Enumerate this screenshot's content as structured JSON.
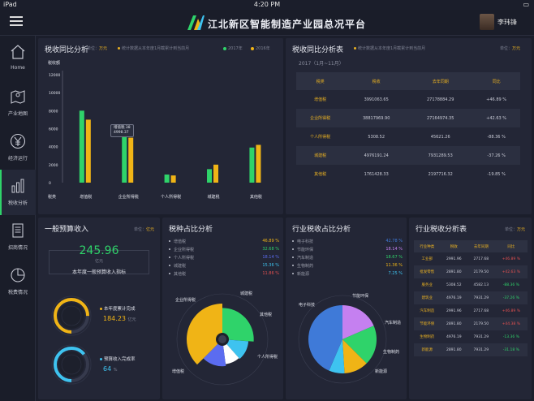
{
  "status": {
    "carrier": "iPad",
    "time": "4:20 PM",
    "battery": "100%"
  },
  "header": {
    "title": "江北新区智能制造产业园总况平台",
    "user": "李玮锋"
  },
  "nav": [
    {
      "label": "Home",
      "icon": "home-icon"
    },
    {
      "label": "产业地图",
      "icon": "map-pin-icon"
    },
    {
      "label": "经济运行",
      "icon": "yen-icon"
    },
    {
      "label": "税收分析",
      "icon": "bar-chart-icon"
    },
    {
      "label": "招商情况",
      "icon": "document-icon"
    },
    {
      "label": "税费情况",
      "icon": "pie-icon"
    }
  ],
  "tax_compare": {
    "title": "税收同比分析",
    "unit_label": "单位：",
    "unit_value": "万元",
    "note": "统计数据从本年度1月截累计到当前月",
    "legend": [
      "2017年",
      "2016年"
    ],
    "tooltip": [
      "增值税 38",
      "4998.37"
    ]
  },
  "chart_data": {
    "type": "bar",
    "ylabel": "税收额",
    "xlabel": "税类",
    "ylim": [
      0,
      12000
    ],
    "yticks": [
      "12000",
      "10000",
      "8000",
      "6000",
      "4000",
      "2000",
      "0"
    ],
    "categories": [
      "增值税",
      "企业所得税",
      "个人所得税",
      "城建税",
      "其他税"
    ],
    "series": [
      {
        "name": "2017年",
        "color": "#2fd36a",
        "values": [
          8000,
          5300,
          900,
          1500,
          3900
        ]
      },
      {
        "name": "2016年",
        "color": "#f0b416",
        "values": [
          7000,
          5000,
          800,
          2000,
          4200
        ]
      }
    ]
  },
  "tax_table": {
    "title": "税收同比分析表",
    "note": "统计数据从本年度1月截累计到当前月",
    "unit_label": "单位：",
    "unit_value": "万元",
    "period": "2017（1月~11月）",
    "headers": [
      "税类",
      "税收",
      "去年同期",
      "同比"
    ],
    "rows": [
      [
        "增值税",
        "3991063.65",
        "27178884.29",
        "+46.89 %"
      ],
      [
        "企业所得税",
        "38817969.90",
        "27164974.35",
        "+42.63 %"
      ],
      [
        "个人所得税",
        "5308.52",
        "45621.26",
        "-88.36 %"
      ],
      [
        "城建税",
        "4976191.24",
        "7931289.53",
        "-37.26 %"
      ],
      [
        "其他税",
        "1761428.33",
        "2197716.32",
        "-19.85 %"
      ]
    ]
  },
  "budget": {
    "title": "一般预算收入",
    "unit_label": "单位：",
    "unit_value": "亿元",
    "value": "245.96",
    "value_unit": "亿元",
    "caption": "本年度一般预算收入指标",
    "completed_label": "本年度累计完成",
    "completed_value": "184.23",
    "completed_unit": "亿元",
    "rate_label": "预算收入完成率",
    "rate_value": "64",
    "rate_unit": "%",
    "rate_fraction": 0.64,
    "completed_fraction": 0.75
  },
  "tax_share": {
    "title": "税种占比分析",
    "items": [
      {
        "name": "增值税",
        "value": "46.89 %",
        "color": "#f0b416",
        "pct": 46.89
      },
      {
        "name": "企业所得税",
        "value": "32.68 %",
        "color": "#2fd36a",
        "pct": 32.68
      },
      {
        "name": "个人所得税",
        "value": "18.14 %",
        "color": "#5b6cf0",
        "pct": 18.14
      },
      {
        "name": "城建税",
        "value": "15.36 %",
        "color": "#3ec3f0",
        "pct": 15.36
      },
      {
        "name": "其他税",
        "value": "11.86 %",
        "color": "#ffffff",
        "pct": 11.86
      }
    ],
    "chart_labels": [
      "企业所得税",
      "城建税",
      "其他税",
      "个人所得税",
      "增值税"
    ]
  },
  "industry_share": {
    "title": "行业税收占比分析",
    "items": [
      {
        "name": "电子科技",
        "value": "42.78 %",
        "color": "#3f7ad8",
        "pct": 42.78
      },
      {
        "name": "节能环保",
        "value": "18.14 %",
        "color": "#c580f0",
        "pct": 18.14
      },
      {
        "name": "汽车制造",
        "value": "18.67 %",
        "color": "#2fd36a",
        "pct": 18.67
      },
      {
        "name": "生物制药",
        "value": "11.36 %",
        "color": "#f0b416",
        "pct": 11.36
      },
      {
        "name": "新能源",
        "value": "7.25 %",
        "color": "#3ec3f0",
        "pct": 7.25
      }
    ],
    "chart_labels": [
      "节能环保",
      "电子科技",
      "汽车制造",
      "生物制药",
      "新能源"
    ]
  },
  "industry_table": {
    "title": "行业税收分析表",
    "unit_label": "单位：",
    "unit_value": "万元",
    "headers": [
      "行业种类",
      "税收",
      "去年同期",
      "同比"
    ],
    "rows": [
      [
        "工业部",
        "2991.96",
        "2717.68",
        "+46.89 %"
      ],
      [
        "批发零售",
        "2891.80",
        "2179.50",
        "+42.63 %"
      ],
      [
        "服务业",
        "5308.52",
        "4582.13",
        "-88.36 %"
      ],
      [
        "建筑业",
        "4976.19",
        "7931.29",
        "-37.26 %"
      ],
      [
        "汽车制造",
        "2991.96",
        "2717.68",
        "+46.89 %"
      ],
      [
        "节能环保",
        "2891.80",
        "2179.50",
        "+44.38 %"
      ],
      [
        "生物制药",
        "4976.19",
        "7931.29",
        "-13.36 %"
      ],
      [
        "新能源",
        "2891.80",
        "7931.29",
        "-31.18 %"
      ]
    ]
  }
}
